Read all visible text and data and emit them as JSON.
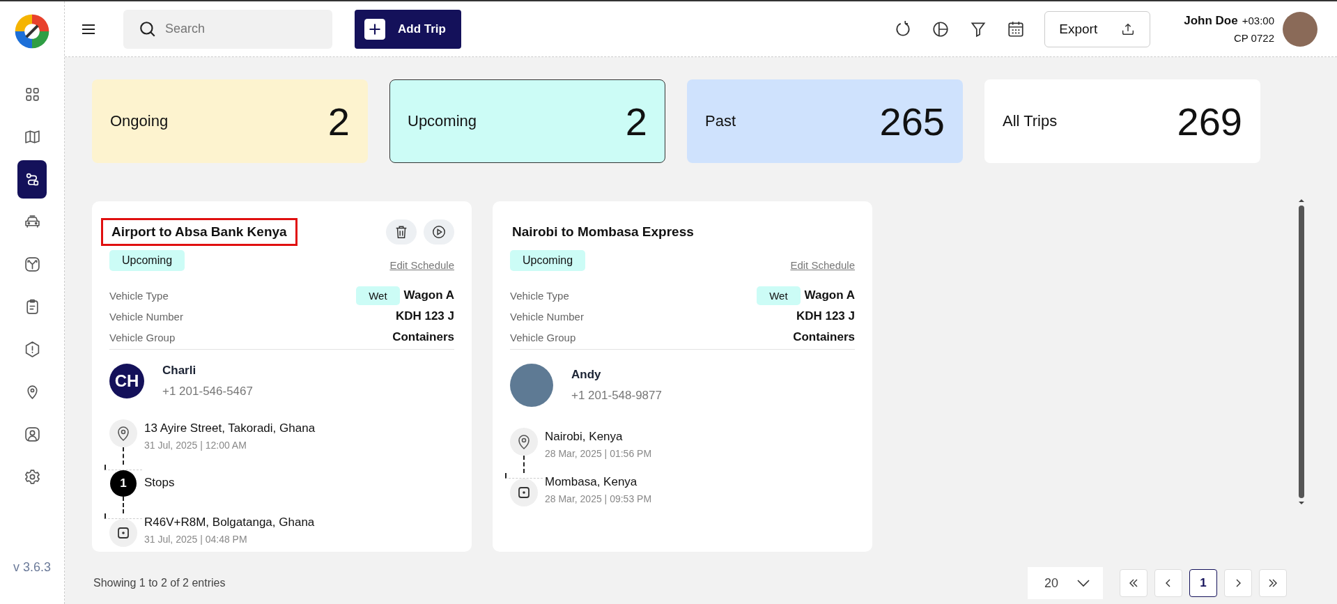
{
  "sidebar": {
    "version": "v 3.6.3",
    "items": [
      {
        "kind": "grid",
        "selected": false
      },
      {
        "kind": "map",
        "selected": false
      },
      {
        "kind": "route",
        "selected": true
      },
      {
        "kind": "car",
        "selected": false
      },
      {
        "kind": "fork",
        "selected": false
      },
      {
        "kind": "clipboard",
        "selected": false
      },
      {
        "kind": "alert",
        "selected": false
      },
      {
        "kind": "pin",
        "selected": false
      },
      {
        "kind": "user",
        "selected": false
      },
      {
        "kind": "gear",
        "selected": false
      }
    ]
  },
  "header": {
    "search": {
      "placeholder": "Search"
    },
    "add_button": "Add Trip",
    "export_button": "Export",
    "user": {
      "name": "John Doe",
      "timezone": "+03:00",
      "code": "CP 0722"
    }
  },
  "stats": [
    {
      "label": "Ongoing",
      "value": "2",
      "color": "#fdf3cf",
      "selected": false
    },
    {
      "label": "Upcoming",
      "value": "2",
      "color": "#ccfcf6",
      "selected": true
    },
    {
      "label": "Past",
      "value": "265",
      "color": "#cfe2fd",
      "selected": false
    },
    {
      "label": "All Trips",
      "value": "269",
      "color": "#ffffff",
      "selected": false
    }
  ],
  "trips": [
    {
      "title": "Airport to Absa Bank Kenya",
      "highlighted": true,
      "actions": true,
      "status": "Upcoming",
      "edit_link": "Edit Schedule",
      "details": [
        {
          "label": "Vehicle Type",
          "tag": "Wet",
          "value": "Wagon A"
        },
        {
          "label": "Vehicle Number",
          "value": "KDH 123 J"
        },
        {
          "label": "Vehicle Group",
          "value": "Containers"
        }
      ],
      "driver": {
        "kind": "initials",
        "initials": "CH",
        "name": "Charli",
        "phone": "+1 201-546-5467"
      },
      "route": [
        {
          "kind": "start",
          "place": "13 Ayire Street, Takoradi, Ghana",
          "time": "31 Jul, 2025 | 12:00 AM"
        },
        {
          "kind": "stops",
          "count": "1",
          "place": "Stops"
        },
        {
          "kind": "end",
          "place": "R46V+R8M, Bolgatanga, Ghana",
          "time": "31 Jul, 2025 | 04:48 PM"
        }
      ]
    },
    {
      "title": "Nairobi to Mombasa Express",
      "highlighted": false,
      "actions": false,
      "status": "Upcoming",
      "edit_link": "Edit Schedule",
      "details": [
        {
          "label": "Vehicle Type",
          "tag": "Wet",
          "value": "Wagon A"
        },
        {
          "label": "Vehicle Number",
          "value": "KDH 123 J"
        },
        {
          "label": "Vehicle Group",
          "value": "Containers"
        }
      ],
      "driver": {
        "kind": "photo",
        "name": "Andy",
        "phone": "+1 201-548-9877"
      },
      "route": [
        {
          "kind": "start",
          "place": "Nairobi, Kenya",
          "time": "28 Mar, 2025 | 01:56 PM"
        },
        {
          "kind": "end",
          "place": "Mombasa, Kenya",
          "time": "28 Mar, 2025 | 09:53 PM"
        }
      ]
    }
  ],
  "footer": {
    "summary": "Showing 1 to 2 of 2 entries",
    "per_page": "20",
    "pages": [
      {
        "label": "1",
        "selected": true
      }
    ]
  }
}
